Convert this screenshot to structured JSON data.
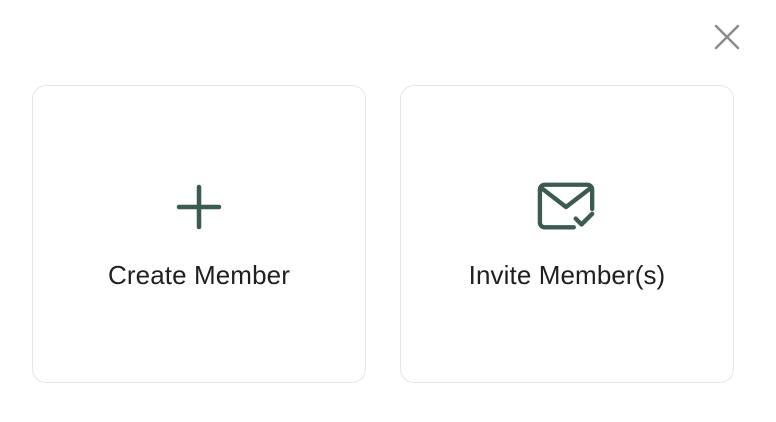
{
  "dialog": {
    "close_icon": "close-icon",
    "options": [
      {
        "label": "Create Member",
        "icon": "plus-icon"
      },
      {
        "label": "Invite Member(s)",
        "icon": "mail-check-icon"
      }
    ]
  },
  "colors": {
    "icon": "#3b5b52",
    "close": "#8a8a8a",
    "card_border": "#e6e6e6",
    "text": "#1f1f1f"
  }
}
